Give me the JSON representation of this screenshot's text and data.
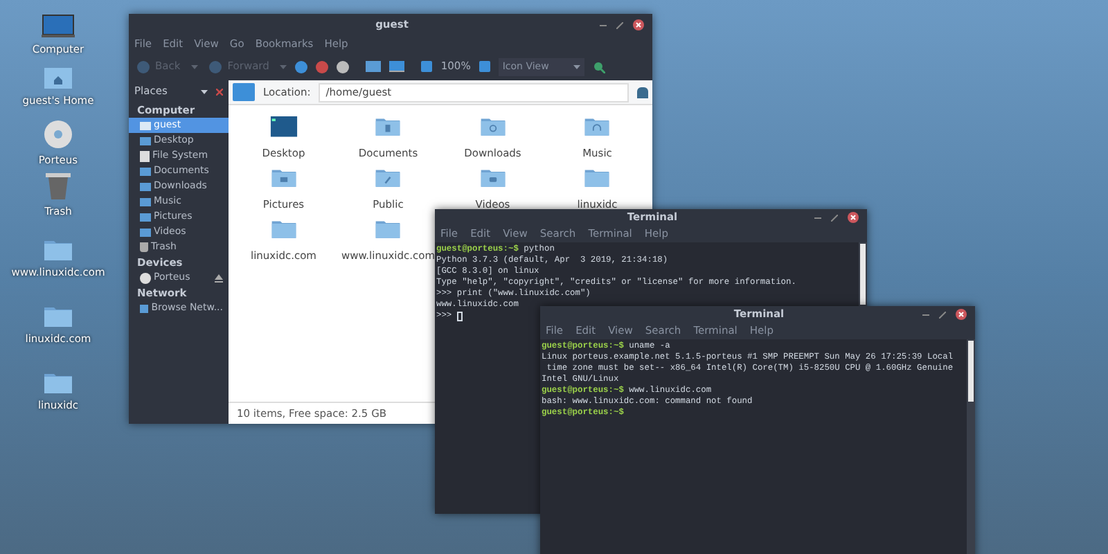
{
  "desktop_icons": [
    {
      "label": "Computer",
      "kind": "computer"
    },
    {
      "label": "guest's Home",
      "kind": "home"
    },
    {
      "label": "Porteus",
      "kind": "disc"
    },
    {
      "label": "Trash",
      "kind": "trash"
    },
    {
      "label": "www.linuxidc.com",
      "kind": "folder"
    },
    {
      "label": "linuxidc.com",
      "kind": "folder"
    },
    {
      "label": "linuxidc",
      "kind": "folder"
    }
  ],
  "file_manager": {
    "title": "guest",
    "menu": [
      "File",
      "Edit",
      "View",
      "Go",
      "Bookmarks",
      "Help"
    ],
    "toolbar": {
      "back": {
        "label": "Back",
        "disabled": true
      },
      "forward": {
        "label": "Forward",
        "disabled": true
      },
      "zoom_level": "100%",
      "view_mode": "Icon View"
    },
    "sidebar": {
      "header": "Places",
      "sections": [
        {
          "title": "Computer",
          "items": [
            {
              "label": "guest",
              "kind": "home",
              "selected": true,
              "ejectable": false
            },
            {
              "label": "Desktop",
              "kind": "folder",
              "selected": false,
              "ejectable": false
            },
            {
              "label": "File System",
              "kind": "drive",
              "selected": false,
              "ejectable": false
            },
            {
              "label": "Documents",
              "kind": "folder",
              "selected": false,
              "ejectable": false
            },
            {
              "label": "Downloads",
              "kind": "folder",
              "selected": false,
              "ejectable": false
            },
            {
              "label": "Music",
              "kind": "folder",
              "selected": false,
              "ejectable": false
            },
            {
              "label": "Pictures",
              "kind": "folder",
              "selected": false,
              "ejectable": false
            },
            {
              "label": "Videos",
              "kind": "folder",
              "selected": false,
              "ejectable": false
            },
            {
              "label": "Trash",
              "kind": "trash",
              "selected": false,
              "ejectable": false
            }
          ]
        },
        {
          "title": "Devices",
          "items": [
            {
              "label": "Porteus",
              "kind": "disc",
              "selected": false,
              "ejectable": true
            }
          ]
        },
        {
          "title": "Network",
          "items": [
            {
              "label": "Browse Netw...",
              "kind": "folder",
              "selected": false,
              "ejectable": false
            }
          ]
        }
      ]
    },
    "location": {
      "label": "Location:",
      "value": "/home/guest"
    },
    "items": [
      {
        "label": "Desktop",
        "kind": "desktop"
      },
      {
        "label": "Documents",
        "kind": "documents"
      },
      {
        "label": "Downloads",
        "kind": "downloads"
      },
      {
        "label": "Music",
        "kind": "music"
      },
      {
        "label": "Pictures",
        "kind": "pictures"
      },
      {
        "label": "Public",
        "kind": "public"
      },
      {
        "label": "Videos",
        "kind": "videos"
      },
      {
        "label": "linuxidc",
        "kind": "plain"
      },
      {
        "label": "linuxidc.com",
        "kind": "plain"
      },
      {
        "label": "www.linuxidc.com",
        "kind": "plain"
      }
    ],
    "status_bar": "10 items, Free space: 2.5 GB"
  },
  "terminals": [
    {
      "title": "Terminal",
      "menu": [
        "File",
        "Edit",
        "View",
        "Search",
        "Terminal",
        "Help"
      ],
      "lines": [
        {
          "kind": "prompt",
          "prompt": "guest@porteus:~$",
          "command": "python"
        },
        {
          "kind": "output",
          "text": "Python 3.7.3 (default, Apr  3 2019, 21:34:18)"
        },
        {
          "kind": "output",
          "text": "[GCC 8.3.0] on linux"
        },
        {
          "kind": "output",
          "text": "Type \"help\", \"copyright\", \"credits\" or \"license\" for more information."
        },
        {
          "kind": "output",
          "text": ">>> print (\"www.linuxidc.com\")"
        },
        {
          "kind": "output",
          "text": "www.linuxidc.com"
        },
        {
          "kind": "cursor",
          "text": ">>>"
        }
      ]
    },
    {
      "title": "Terminal",
      "menu": [
        "File",
        "Edit",
        "View",
        "Search",
        "Terminal",
        "Help"
      ],
      "lines": [
        {
          "kind": "prompt",
          "prompt": "guest@porteus:~$",
          "command": "uname -a"
        },
        {
          "kind": "output",
          "text": "Linux porteus.example.net 5.1.5-porteus #1 SMP PREEMPT Sun May 26 17:25:39 Local"
        },
        {
          "kind": "output",
          "text": " time zone must be set-- x86_64 Intel(R) Core(TM) i5-8250U CPU @ 1.60GHz Genuine"
        },
        {
          "kind": "output",
          "text": "Intel GNU/Linux"
        },
        {
          "kind": "prompt",
          "prompt": "guest@porteus:~$",
          "command": "www.linuxidc.com"
        },
        {
          "kind": "output",
          "text": "bash: www.linuxidc.com: command not found"
        },
        {
          "kind": "prompt",
          "prompt": "guest@porteus:~$"
        }
      ]
    }
  ]
}
